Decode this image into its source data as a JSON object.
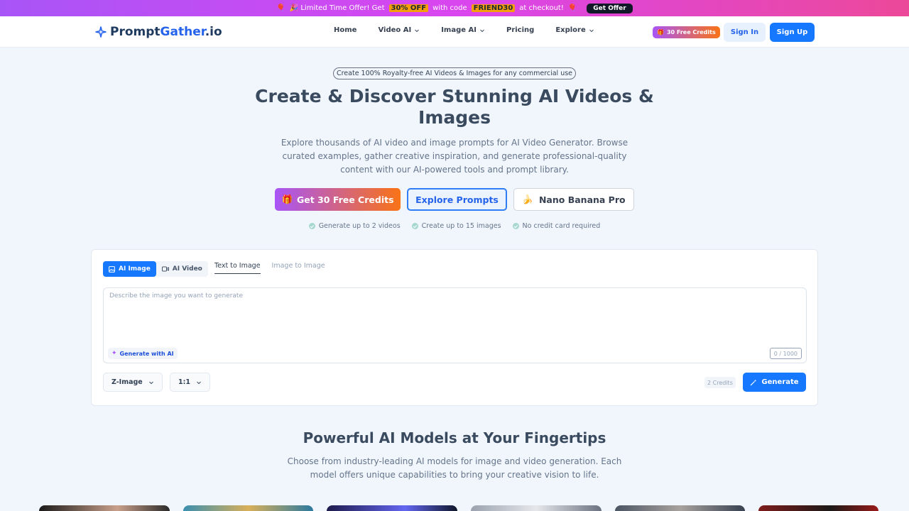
{
  "promo": {
    "prefix": "🎉 Limited Time Offer! Get",
    "discount": "30% OFF",
    "middle": "with code",
    "code": "FRIEND30",
    "suffix": "at checkout!",
    "button": "Get Offer"
  },
  "header": {
    "logo_main": "Prompt",
    "logo_accent": "Gather",
    "logo_suffix": ".io",
    "nav": [
      "Home",
      "Video AI",
      "Image AI",
      "Pricing",
      "Explore"
    ],
    "credits_pill": "30 Free Credits",
    "signin": "Sign In",
    "signup": "Sign Up"
  },
  "hero": {
    "tagline": "Create 100% Royalty-free AI Videos & Images for any commercial use",
    "title": "Create & Discover Stunning AI Videos & Images",
    "subtitle": "Explore thousands of AI video and image prompts for AI Video Generator. Browse curated examples, gather creative inspiration, and generate professional-quality content with our AI-powered tools and prompt library.",
    "btn_credits": "Get 30 Free Credits",
    "btn_explore": "Explore Prompts",
    "btn_nano": "Nano Banana Pro",
    "features": [
      "Generate up to 2 videos",
      "Create up to 15 images",
      "No credit card required"
    ]
  },
  "generator": {
    "mode_tabs": [
      "AI Image",
      "AI Video"
    ],
    "sub_tabs": [
      "Text to Image",
      "Image to Image"
    ],
    "placeholder": "Describe the image you want to generate",
    "generate_with_ai": "Generate with AI",
    "counter": "0 / 1000",
    "model_select": "Z-Image",
    "ratio_select": "1:1",
    "cost": "2 Credits",
    "generate": "Generate"
  },
  "models": {
    "title": "Powerful AI Models at Your Fingertips",
    "subtitle": "Choose from industry-leading AI models for image and video generation. Each model offers unique capabilities to bring your creative vision to life."
  },
  "colors": {
    "accent": "#1677ff",
    "gradient_start": "#a855f7",
    "gradient_end": "#f97316"
  }
}
